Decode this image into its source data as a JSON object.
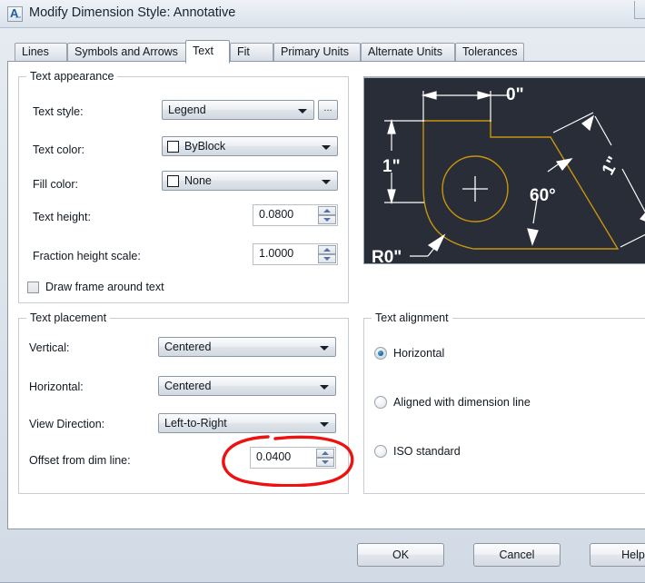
{
  "window": {
    "title": "Modify Dimension Style: Annotative",
    "icon": "autocad-a-icon"
  },
  "tabs": [
    {
      "label": "Lines",
      "active": false
    },
    {
      "label": "Symbols and Arrows",
      "active": false
    },
    {
      "label": "Text",
      "active": true
    },
    {
      "label": "Fit",
      "active": false
    },
    {
      "label": "Primary Units",
      "active": false
    },
    {
      "label": "Alternate Units",
      "active": false
    },
    {
      "label": "Tolerances",
      "active": false
    }
  ],
  "text_appearance": {
    "title": "Text appearance",
    "text_style": {
      "label": "Text style:",
      "value": "Legend",
      "browse_label": "..."
    },
    "text_color": {
      "label": "Text color:",
      "value": "ByBlock",
      "swatch": "#ffffff"
    },
    "fill_color": {
      "label": "Fill color:",
      "value": "None",
      "swatch": "#ffffff"
    },
    "text_height": {
      "label": "Text height:",
      "value": "0.0800"
    },
    "fraction_height_scale": {
      "label": "Fraction height scale:",
      "value": "1.0000"
    },
    "draw_frame": {
      "label": "Draw frame around text",
      "checked": false
    }
  },
  "text_placement": {
    "title": "Text placement",
    "vertical": {
      "label": "Vertical:",
      "value": "Centered"
    },
    "horizontal": {
      "label": "Horizontal:",
      "value": "Centered"
    },
    "view_direction": {
      "label": "View Direction:",
      "value": "Left-to-Right"
    },
    "offset_from_dim_line": {
      "label": "Offset from dim line:",
      "value": "0.0400"
    }
  },
  "text_alignment": {
    "title": "Text alignment",
    "options": [
      {
        "label": "Horizontal",
        "selected": true
      },
      {
        "label": "Aligned with dimension line",
        "selected": false
      },
      {
        "label": "ISO standard",
        "selected": false
      }
    ]
  },
  "preview": {
    "background": "#282d38",
    "geometry_color": "#c8960c",
    "dimension_color": "#ffffff",
    "labels": [
      {
        "text": "0\"",
        "position": "top"
      },
      {
        "text": "1\"",
        "position": "left"
      },
      {
        "text": "1\"",
        "position": "right"
      },
      {
        "text": "60°",
        "position": "center-bottom"
      },
      {
        "text": "R0\"",
        "position": "bottom-left"
      }
    ]
  },
  "annotation": {
    "shape": "red-ellipse-highlight",
    "color": "#ee1111",
    "target": "offset-from-dim-line-field"
  },
  "buttons": {
    "ok": "OK",
    "cancel": "Cancel",
    "help": "Help"
  }
}
